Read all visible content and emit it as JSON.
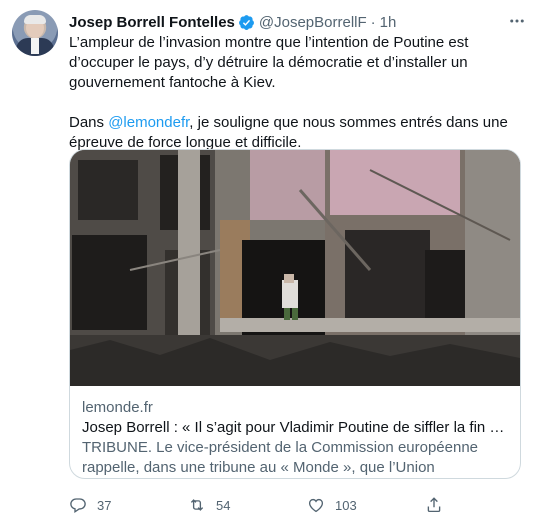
{
  "author": {
    "name": "Josep Borrell Fontelles",
    "handle": "@JosepBorrellF",
    "separator": "·",
    "time": "1h"
  },
  "tweet": {
    "line1": "L’ampleur de l’invasion montre que l’intention de Poutine est d’occuper le pays, d’y détruire la démocratie et d’installer un gouvernement fantoche à Kiev.",
    "line2_prefix": "Dans ",
    "line2_mention": "@lemondefr",
    "line2_suffix": ", je souligne que nous sommes entrés dans une épreuve de force longue et difficile."
  },
  "card": {
    "domain": "lemonde.fr",
    "title": "Josep Borrell : « Il s’agit pour Vladimir Poutine de siffler la fin de la récr…",
    "description": "TRIBUNE. Le vice-président de la Commission européenne rappelle, dans une tribune au « Monde », que l’Union européenne refuse toute …"
  },
  "actions": {
    "reply_count": "37",
    "retweet_count": "54",
    "like_count": "103"
  },
  "colors": {
    "accent": "#1d9bf0",
    "text": "#0f1419",
    "secondary": "#536471",
    "border": "#cfd9de"
  },
  "icons": {
    "verified": "verified-badge-icon",
    "more": "more-icon",
    "reply": "reply-icon",
    "retweet": "retweet-icon",
    "like": "heart-icon",
    "share": "share-icon"
  }
}
